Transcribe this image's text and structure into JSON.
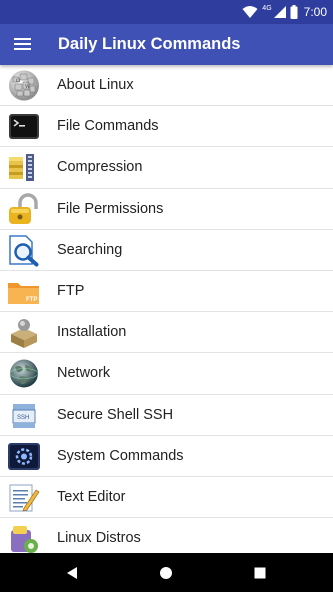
{
  "status_bar": {
    "time": "7:00",
    "network": "4G"
  },
  "app_bar": {
    "title": "Daily Linux Commands"
  },
  "menu_items": [
    {
      "label": "About Linux",
      "icon": "wikipedia-globe-icon"
    },
    {
      "label": "File Commands",
      "icon": "terminal-icon"
    },
    {
      "label": "Compression",
      "icon": "archive-zipper-icon"
    },
    {
      "label": "File Permissions",
      "icon": "padlock-icon"
    },
    {
      "label": "Searching",
      "icon": "magnifier-icon"
    },
    {
      "label": "FTP",
      "icon": "ftp-folder-icon"
    },
    {
      "label": "Installation",
      "icon": "install-package-icon"
    },
    {
      "label": "Network",
      "icon": "globe-network-icon"
    },
    {
      "label": "Secure Shell SSH",
      "icon": "ssh-icon"
    },
    {
      "label": "System Commands",
      "icon": "system-monitor-icon"
    },
    {
      "label": "Text Editor",
      "icon": "text-editor-icon"
    },
    {
      "label": "Linux Distros",
      "icon": "distros-icon"
    }
  ],
  "icon_texts": {
    "ftp": "FTP",
    "ssh": "SSH"
  },
  "colors": {
    "status_bar": "#2f3e9e",
    "app_bar": "#3f51b5",
    "nav_bar": "#000000"
  }
}
